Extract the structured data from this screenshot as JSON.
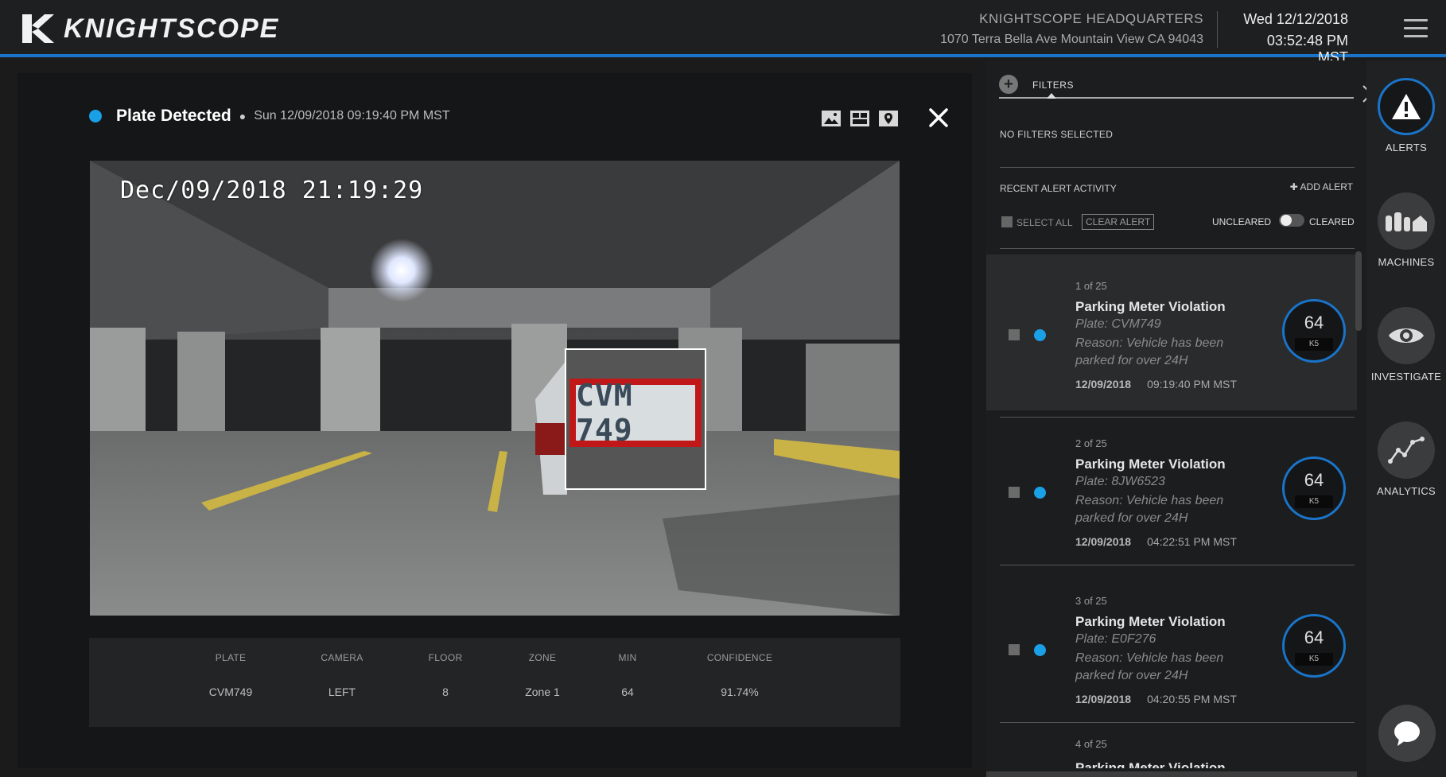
{
  "header": {
    "logo_text": "KNIGHTSCOPE",
    "site_name": "KNIGHTSCOPE HEADQUARTERS",
    "site_address": "1070 Terra Bella Ave Mountain View CA 94043",
    "date": "Wed 12/12/2018",
    "time": "03:52:48 PM MST"
  },
  "detail": {
    "title": "Plate Detected",
    "timestamp": "Sun 12/09/2018 09:19:40 PM MST",
    "camera_stamp": "Dec/09/2018  21:19:29",
    "plate_crop_text": "CVM 749",
    "table": {
      "headers": [
        "PLATE",
        "CAMERA",
        "FLOOR",
        "ZONE",
        "MIN",
        "CONFIDENCE"
      ],
      "values": [
        "CVM749",
        "LEFT",
        "8",
        "Zone 1",
        "64",
        "91.74%"
      ]
    }
  },
  "alerts_panel": {
    "filters_label": "FILTERS",
    "no_filters": "NO FILTERS SELECTED",
    "recent_label": "RECENT ALERT ACTIVITY",
    "add_alert": "ADD ALERT",
    "select_all": "SELECT ALL",
    "clear_alert": "CLEAR ALERT",
    "uncleared": "UNCLEARED",
    "cleared": "CLEARED",
    "items": [
      {
        "count": "1 of 25",
        "title": "Parking Meter Violation",
        "plate": "Plate: CVM749",
        "reason": "Reason: Vehicle has been parked for over 24H",
        "date": "12/09/2018",
        "time": "09:19:40 PM MST",
        "ring_value": "64",
        "ring_unit": "K5"
      },
      {
        "count": "2 of 25",
        "title": "Parking Meter Violation",
        "plate": "Plate: 8JW6523",
        "reason": "Reason: Vehicle has been parked for over 24H",
        "date": "12/09/2018",
        "time": "04:22:51 PM MST",
        "ring_value": "64",
        "ring_unit": "K5"
      },
      {
        "count": "3 of 25",
        "title": "Parking Meter Violation",
        "plate": "Plate: E0F276",
        "reason": "Reason: Vehicle has been parked for over 24H",
        "date": "12/09/2018",
        "time": "04:20:55 PM MST",
        "ring_value": "64",
        "ring_unit": "K5"
      }
    ],
    "partial_item_count": "4 of 25",
    "partial_item_title": "Parking Meter Violation"
  },
  "nav": {
    "alerts": "ALERTS",
    "machines": "MACHINES",
    "investigate": "INVESTIGATE",
    "analytics": "ANALYTICS"
  },
  "colors": {
    "accent": "#1a74c9",
    "status_dot": "#1aa0e6",
    "plate_box": "#c01818"
  }
}
